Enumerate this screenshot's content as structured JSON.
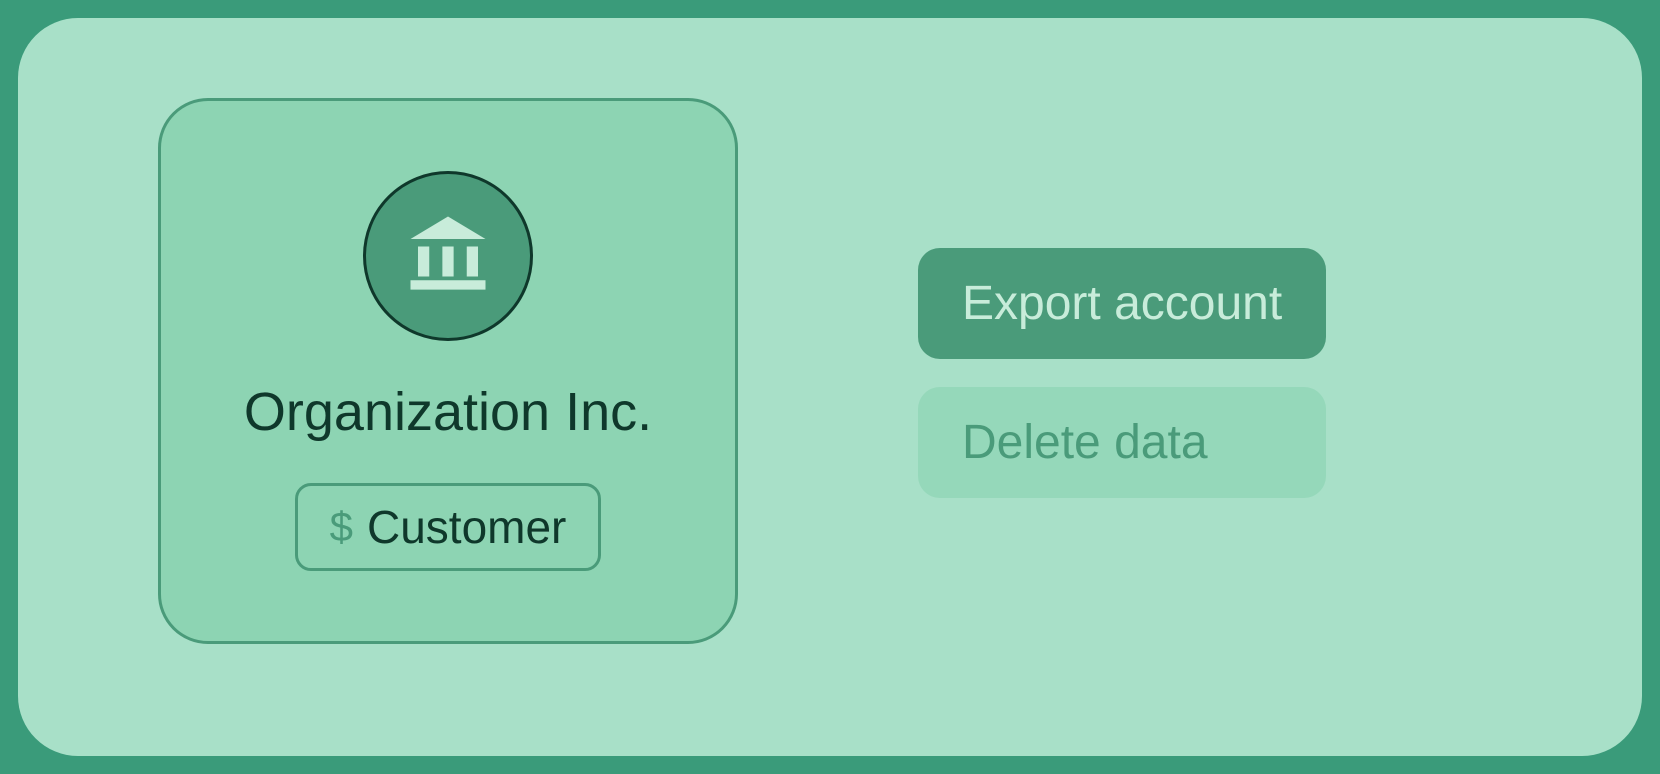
{
  "organization": {
    "name": "Organization Inc.",
    "badge": {
      "icon_glyph": "$",
      "label": "Customer"
    }
  },
  "actions": {
    "export_label": "Export account",
    "delete_label": "Delete data"
  }
}
